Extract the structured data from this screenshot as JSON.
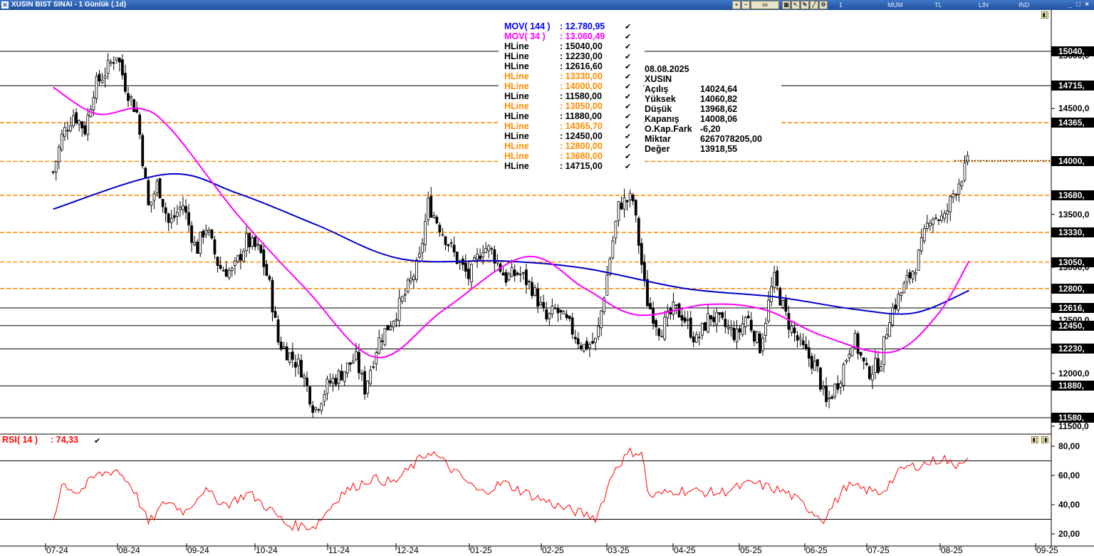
{
  "window": {
    "title": "XUSIN BIST SINAI - 1 Günlük (.1d)",
    "modes": [
      "1 Günlük",
      "MUM",
      "TL",
      "LIN",
      "IND"
    ],
    "close_label": "×",
    "minimize_label": "_",
    "maximize_label": "□"
  },
  "legend": [
    {
      "name": "MOV( 144 )",
      "value": ": 12.780,95",
      "color": "#0000ff"
    },
    {
      "name": "MOV( 34 )",
      "value": ": 13.060,49",
      "color": "#ff00ff"
    },
    {
      "name": "HLine",
      "value": ": 15040,00",
      "color": "#000000"
    },
    {
      "name": "HLine",
      "value": ": 12230,00",
      "color": "#000000"
    },
    {
      "name": "HLine",
      "value": ": 12616,60",
      "color": "#000000"
    },
    {
      "name": "HLine",
      "value": ": 13330,00",
      "color": "#ff8c00"
    },
    {
      "name": "HLine",
      "value": ": 14000,00",
      "color": "#ff8c00"
    },
    {
      "name": "HLine",
      "value": ": 11580,00",
      "color": "#000000"
    },
    {
      "name": "HLine",
      "value": ": 13050,00",
      "color": "#ff8c00"
    },
    {
      "name": "HLine",
      "value": ": 11880,00",
      "color": "#000000"
    },
    {
      "name": "HLine",
      "value": ": 14365,70",
      "color": "#ff8c00"
    },
    {
      "name": "HLine",
      "value": ": 12450,00",
      "color": "#000000"
    },
    {
      "name": "HLine",
      "value": ": 12800,00",
      "color": "#ff8c00"
    },
    {
      "name": "HLine",
      "value": ": 13680,00",
      "color": "#ff8c00"
    },
    {
      "name": "HLine",
      "value": ": 14715,00",
      "color": "#000000"
    }
  ],
  "info_panel": {
    "date": "08.08.2025",
    "symbol": "XUSIN",
    "rows": [
      {
        "label": "Açılış",
        "value": "14024,64"
      },
      {
        "label": "Yüksek",
        "value": "14060,82"
      },
      {
        "label": "Düşük",
        "value": "13968,62"
      },
      {
        "label": "Kapanış",
        "value": "14008,06"
      },
      {
        "label": "O.Kap.Fark",
        "value": "-6,20"
      },
      {
        "label": "Miktar",
        "value": "6267078205,00"
      },
      {
        "label": "Değer",
        "value": "13918,55"
      }
    ]
  },
  "price_boxes": [
    {
      "label": "15040,",
      "value": 15040,
      "dashed": false
    },
    {
      "label": "14715,",
      "value": 14715,
      "dashed": false
    },
    {
      "label": "14365,",
      "value": 14365.7,
      "dashed": true
    },
    {
      "label": "14000,",
      "value": 14000,
      "dashed": true
    },
    {
      "label": "13680,",
      "value": 13680,
      "dashed": true
    },
    {
      "label": "13330,",
      "value": 13330,
      "dashed": true
    },
    {
      "label": "13050,",
      "value": 13050,
      "dashed": true
    },
    {
      "label": "12800,",
      "value": 12800,
      "dashed": true
    },
    {
      "label": "12616,",
      "value": 12616.6,
      "dashed": false
    },
    {
      "label": "12450,",
      "value": 12450,
      "dashed": false
    },
    {
      "label": "12230,",
      "value": 12230,
      "dashed": false
    },
    {
      "label": "11880,",
      "value": 11880,
      "dashed": false
    },
    {
      "label": "11580,",
      "value": 11580,
      "dashed": false
    }
  ],
  "price_ticks": [
    {
      "label": "15000,0",
      "value": 15000
    },
    {
      "label": "14500,0",
      "value": 14500
    },
    {
      "label": "14000,0",
      "value": 14000
    },
    {
      "label": "13500,0",
      "value": 13500
    },
    {
      "label": "13000,0",
      "value": 13000
    },
    {
      "label": "12500,0",
      "value": 12500
    },
    {
      "label": "12000,0",
      "value": 12000
    },
    {
      "label": "11500,0",
      "value": 11500
    }
  ],
  "rsi": {
    "label": "RSI( 14 )",
    "value": ": 74,33",
    "color": "#ff0000",
    "ticks": [
      "80,00",
      "60,00",
      "40,00",
      "20,00"
    ],
    "levels": [
      70,
      30
    ]
  },
  "x_labels": [
    "07-24",
    "08-24",
    "09-24",
    "10-24",
    "11-24",
    "12-24",
    "01-25",
    "02-25",
    "03-25",
    "04-25",
    "05-25",
    "06-25",
    "07-25",
    "08-25",
    "09-25"
  ],
  "colors": {
    "mov144": "#0000cc",
    "mov34": "#ff00ff",
    "hline_orange": "#ff8c00",
    "rsi": "#ff0000"
  },
  "chart_data": [
    {
      "type": "candlestick",
      "title": "XUSIN BIST SINAI - 1 Günlük (.1d)",
      "x_labels": [
        "07-24",
        "08-24",
        "09-24",
        "10-24",
        "11-24",
        "12-24",
        "01-25",
        "02-25",
        "03-25",
        "04-25",
        "05-25",
        "06-25",
        "07-25",
        "08-25",
        "09-25"
      ],
      "ylim": [
        11450,
        15150
      ],
      "close_approx": [
        {
          "x": "2024-07-01",
          "y": 13900
        },
        {
          "x": "2024-07-05",
          "y": 14250
        },
        {
          "x": "2024-07-10",
          "y": 14450
        },
        {
          "x": "2024-07-15",
          "y": 14300
        },
        {
          "x": "2024-07-19",
          "y": 14700
        },
        {
          "x": "2024-07-24",
          "y": 14850
        },
        {
          "x": "2024-07-29",
          "y": 15020
        },
        {
          "x": "2024-08-02",
          "y": 14700
        },
        {
          "x": "2024-08-07",
          "y": 14450
        },
        {
          "x": "2024-08-12",
          "y": 13550
        },
        {
          "x": "2024-08-16",
          "y": 13800
        },
        {
          "x": "2024-08-21",
          "y": 13400
        },
        {
          "x": "2024-08-27",
          "y": 13600
        },
        {
          "x": "2024-09-02",
          "y": 13150
        },
        {
          "x": "2024-09-06",
          "y": 13400
        },
        {
          "x": "2024-09-12",
          "y": 13000
        },
        {
          "x": "2024-09-18",
          "y": 12950
        },
        {
          "x": "2024-09-24",
          "y": 13250
        },
        {
          "x": "2024-09-30",
          "y": 13150
        },
        {
          "x": "2024-10-04",
          "y": 12850
        },
        {
          "x": "2024-10-08",
          "y": 12300
        },
        {
          "x": "2024-10-14",
          "y": 12150
        },
        {
          "x": "2024-10-18",
          "y": 12050
        },
        {
          "x": "2024-10-24",
          "y": 11650
        },
        {
          "x": "2024-10-30",
          "y": 11900
        },
        {
          "x": "2024-11-05",
          "y": 12000
        },
        {
          "x": "2024-11-11",
          "y": 12150
        },
        {
          "x": "2024-11-15",
          "y": 11850
        },
        {
          "x": "2024-11-21",
          "y": 12300
        },
        {
          "x": "2024-11-27",
          "y": 12500
        },
        {
          "x": "2024-12-03",
          "y": 12750
        },
        {
          "x": "2024-12-09",
          "y": 13050
        },
        {
          "x": "2024-12-13",
          "y": 13600
        },
        {
          "x": "2024-12-19",
          "y": 13350
        },
        {
          "x": "2024-12-25",
          "y": 13100
        },
        {
          "x": "2024-12-31",
          "y": 12900
        },
        {
          "x": "2025-01-06",
          "y": 13200
        },
        {
          "x": "2025-01-10",
          "y": 13150
        },
        {
          "x": "2025-01-16",
          "y": 12900
        },
        {
          "x": "2025-01-22",
          "y": 12950
        },
        {
          "x": "2025-01-28",
          "y": 12800
        },
        {
          "x": "2025-02-03",
          "y": 12500
        },
        {
          "x": "2025-02-07",
          "y": 12600
        },
        {
          "x": "2025-02-13",
          "y": 12450
        },
        {
          "x": "2025-02-19",
          "y": 12250
        },
        {
          "x": "2025-02-25",
          "y": 12300
        },
        {
          "x": "2025-03-03",
          "y": 13100
        },
        {
          "x": "2025-03-07",
          "y": 13600
        },
        {
          "x": "2025-03-13",
          "y": 13650
        },
        {
          "x": "2025-03-19",
          "y": 12700
        },
        {
          "x": "2025-03-25",
          "y": 12400
        },
        {
          "x": "2025-03-31",
          "y": 12600
        },
        {
          "x": "2025-04-04",
          "y": 12550
        },
        {
          "x": "2025-04-10",
          "y": 12300
        },
        {
          "x": "2025-04-16",
          "y": 12550
        },
        {
          "x": "2025-04-22",
          "y": 12450
        },
        {
          "x": "2025-04-28",
          "y": 12350
        },
        {
          "x": "2025-05-02",
          "y": 12550
        },
        {
          "x": "2025-05-08",
          "y": 12250
        },
        {
          "x": "2025-05-14",
          "y": 12900
        },
        {
          "x": "2025-05-20",
          "y": 12500
        },
        {
          "x": "2025-05-26",
          "y": 12250
        },
        {
          "x": "2025-06-02",
          "y": 12050
        },
        {
          "x": "2025-06-06",
          "y": 11700
        },
        {
          "x": "2025-06-12",
          "y": 11950
        },
        {
          "x": "2025-06-18",
          "y": 12350
        },
        {
          "x": "2025-06-24",
          "y": 12000
        },
        {
          "x": "2025-06-30",
          "y": 12100
        },
        {
          "x": "2025-07-04",
          "y": 12550
        },
        {
          "x": "2025-07-10",
          "y": 12800
        },
        {
          "x": "2025-07-16",
          "y": 13050
        },
        {
          "x": "2025-07-22",
          "y": 13500
        },
        {
          "x": "2025-07-28",
          "y": 13450
        },
        {
          "x": "2025-08-01",
          "y": 13700
        },
        {
          "x": "2025-08-08",
          "y": 14008
        }
      ],
      "series": [
        {
          "name": "MOV( 144 )",
          "values_approx": [
            {
              "x": "2024-07-01",
              "y": 13550
            },
            {
              "x": "2024-08-20",
              "y": 13880
            },
            {
              "x": "2024-09-20",
              "y": 13700
            },
            {
              "x": "2024-10-25",
              "y": 13400
            },
            {
              "x": "2024-12-01",
              "y": 13080
            },
            {
              "x": "2025-01-15",
              "y": 13060
            },
            {
              "x": "2025-02-20",
              "y": 12990
            },
            {
              "x": "2025-04-05",
              "y": 12800
            },
            {
              "x": "2025-05-15",
              "y": 12720
            },
            {
              "x": "2025-06-20",
              "y": 12600
            },
            {
              "x": "2025-07-15",
              "y": 12570
            },
            {
              "x": "2025-08-08",
              "y": 12781
            }
          ]
        },
        {
          "name": "MOV( 34 )",
          "values_approx": [
            {
              "x": "2024-07-01",
              "y": 14700
            },
            {
              "x": "2024-07-20",
              "y": 14450
            },
            {
              "x": "2024-08-08",
              "y": 14500
            },
            {
              "x": "2024-08-22",
              "y": 14300
            },
            {
              "x": "2024-09-20",
              "y": 13500
            },
            {
              "x": "2024-10-20",
              "y": 12800
            },
            {
              "x": "2024-11-20",
              "y": 12150
            },
            {
              "x": "2024-12-20",
              "y": 12600
            },
            {
              "x": "2025-01-25",
              "y": 13100
            },
            {
              "x": "2025-02-20",
              "y": 12800
            },
            {
              "x": "2025-03-15",
              "y": 12550
            },
            {
              "x": "2025-04-15",
              "y": 12650
            },
            {
              "x": "2025-05-10",
              "y": 12600
            },
            {
              "x": "2025-06-05",
              "y": 12350
            },
            {
              "x": "2025-07-05",
              "y": 12200
            },
            {
              "x": "2025-07-25",
              "y": 12550
            },
            {
              "x": "2025-08-08",
              "y": 13060
            }
          ]
        }
      ]
    },
    {
      "type": "line",
      "title": "RSI( 14 )",
      "ylim": [
        15,
        85
      ],
      "ticks": [
        20,
        40,
        60,
        80
      ],
      "series": [
        {
          "name": "RSI( 14 )",
          "values_approx": [
            {
              "x": "2024-07-01",
              "y": 30
            },
            {
              "x": "2024-07-05",
              "y": 55
            },
            {
              "x": "2024-07-12",
              "y": 48
            },
            {
              "x": "2024-07-20",
              "y": 60
            },
            {
              "x": "2024-07-29",
              "y": 64
            },
            {
              "x": "2024-08-05",
              "y": 52
            },
            {
              "x": "2024-08-12",
              "y": 27
            },
            {
              "x": "2024-08-20",
              "y": 43
            },
            {
              "x": "2024-08-28",
              "y": 35
            },
            {
              "x": "2024-09-05",
              "y": 50
            },
            {
              "x": "2024-09-15",
              "y": 40
            },
            {
              "x": "2024-09-25",
              "y": 48
            },
            {
              "x": "2024-10-05",
              "y": 36
            },
            {
              "x": "2024-10-12",
              "y": 26
            },
            {
              "x": "2024-10-24",
              "y": 25
            },
            {
              "x": "2024-11-05",
              "y": 48
            },
            {
              "x": "2024-11-18",
              "y": 58
            },
            {
              "x": "2024-11-28",
              "y": 55
            },
            {
              "x": "2024-12-10",
              "y": 72
            },
            {
              "x": "2024-12-14",
              "y": 77
            },
            {
              "x": "2024-12-25",
              "y": 62
            },
            {
              "x": "2025-01-05",
              "y": 48
            },
            {
              "x": "2025-01-15",
              "y": 55
            },
            {
              "x": "2025-01-28",
              "y": 46
            },
            {
              "x": "2025-02-10",
              "y": 38
            },
            {
              "x": "2025-02-25",
              "y": 31
            },
            {
              "x": "2025-03-05",
              "y": 65
            },
            {
              "x": "2025-03-12",
              "y": 76
            },
            {
              "x": "2025-03-17",
              "y": 76
            },
            {
              "x": "2025-03-20",
              "y": 45
            },
            {
              "x": "2025-04-01",
              "y": 50
            },
            {
              "x": "2025-04-20",
              "y": 48
            },
            {
              "x": "2025-05-05",
              "y": 55
            },
            {
              "x": "2025-05-20",
              "y": 48
            },
            {
              "x": "2025-06-05",
              "y": 30
            },
            {
              "x": "2025-06-15",
              "y": 53
            },
            {
              "x": "2025-06-30",
              "y": 48
            },
            {
              "x": "2025-07-10",
              "y": 65
            },
            {
              "x": "2025-07-20",
              "y": 68
            },
            {
              "x": "2025-07-28",
              "y": 72
            },
            {
              "x": "2025-08-01",
              "y": 66
            },
            {
              "x": "2025-08-08",
              "y": 74.33
            }
          ]
        }
      ]
    }
  ]
}
